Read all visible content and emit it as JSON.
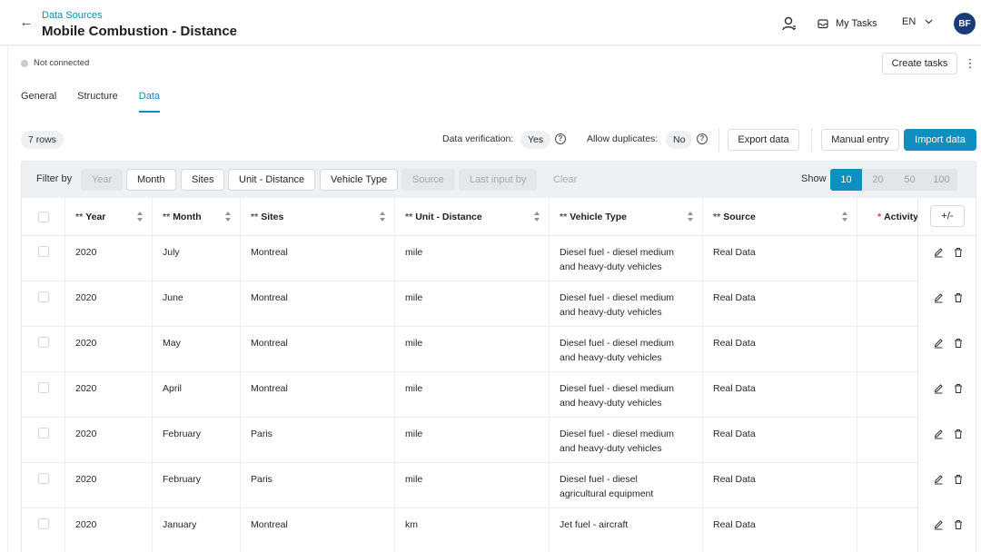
{
  "header": {
    "breadcrumb": "Data Sources",
    "title": "Mobile Combustion - Distance",
    "my_tasks": "My Tasks",
    "language": "EN",
    "avatar_initials": "BF"
  },
  "status": {
    "connection": "Not connected",
    "create_tasks": "Create tasks"
  },
  "tabs": [
    {
      "label": "General",
      "active": false
    },
    {
      "label": "Structure",
      "active": false
    },
    {
      "label": "Data",
      "active": true
    }
  ],
  "toolbar": {
    "rows_count": "7 rows",
    "data_verification_label": "Data verification:",
    "data_verification_value": "Yes",
    "allow_duplicates_label": "Allow duplicates:",
    "allow_duplicates_value": "No",
    "export": "Export data",
    "manual_entry": "Manual entry",
    "import": "Import data"
  },
  "filters": {
    "label": "Filter by",
    "chips": [
      {
        "label": "Year",
        "state": "disabled"
      },
      {
        "label": "Month",
        "state": "enabled"
      },
      {
        "label": "Sites",
        "state": "enabled"
      },
      {
        "label": "Unit - Distance",
        "state": "enabled"
      },
      {
        "label": "Vehicle Type",
        "state": "enabled"
      },
      {
        "label": "Source",
        "state": "disabled"
      },
      {
        "label": "Last input by",
        "state": "disabled"
      },
      {
        "label": "Clear",
        "state": "clear"
      }
    ],
    "show_label": "Show",
    "page_sizes": [
      "10",
      "20",
      "50",
      "100"
    ],
    "selected_page_size": "10"
  },
  "table": {
    "columns": [
      {
        "label": "Year",
        "required": "**"
      },
      {
        "label": "Month",
        "required": "**"
      },
      {
        "label": "Sites",
        "required": "**"
      },
      {
        "label": "Unit - Distance",
        "required": "**"
      },
      {
        "label": "Vehicle Type",
        "required": "**"
      },
      {
        "label": "Source",
        "required": "**"
      },
      {
        "label": "Activity",
        "required": "*"
      }
    ],
    "toggle_columns": "+/-",
    "rows": [
      {
        "year": "2020",
        "month": "July",
        "site": "Montreal",
        "unit": "mile",
        "vehicle_line1": "Diesel fuel - diesel medium",
        "vehicle_line2": "and heavy-duty vehicles",
        "source": "Real Data",
        "activity": ""
      },
      {
        "year": "2020",
        "month": "June",
        "site": "Montreal",
        "unit": "mile",
        "vehicle_line1": "Diesel fuel - diesel medium",
        "vehicle_line2": "and heavy-duty vehicles",
        "source": "Real Data",
        "activity": ""
      },
      {
        "year": "2020",
        "month": "May",
        "site": "Montreal",
        "unit": "mile",
        "vehicle_line1": "Diesel fuel - diesel medium",
        "vehicle_line2": "and heavy-duty vehicles",
        "source": "Real Data",
        "activity": ""
      },
      {
        "year": "2020",
        "month": "April",
        "site": "Montreal",
        "unit": "mile",
        "vehicle_line1": "Diesel fuel - diesel medium",
        "vehicle_line2": "and heavy-duty vehicles",
        "source": "Real Data",
        "activity": ""
      },
      {
        "year": "2020",
        "month": "February",
        "site": "Paris",
        "unit": "mile",
        "vehicle_line1": "Diesel fuel - diesel medium",
        "vehicle_line2": "and heavy-duty vehicles",
        "source": "Real Data",
        "activity": ""
      },
      {
        "year": "2020",
        "month": "February",
        "site": "Paris",
        "unit": "mile",
        "vehicle_line1": "Diesel fuel - diesel",
        "vehicle_line2": "agricultural equipment",
        "source": "Real Data",
        "activity": ""
      },
      {
        "year": "2020",
        "month": "January",
        "site": "Montreal",
        "unit": "km",
        "vehicle_line1": "Jet fuel - aircraft",
        "vehicle_line2": "",
        "source": "Real Data",
        "activity": ""
      }
    ]
  },
  "colors": {
    "accent": "#0e8fbf",
    "avatar": "#1b3c7a",
    "required_marker": "#e0414a"
  }
}
